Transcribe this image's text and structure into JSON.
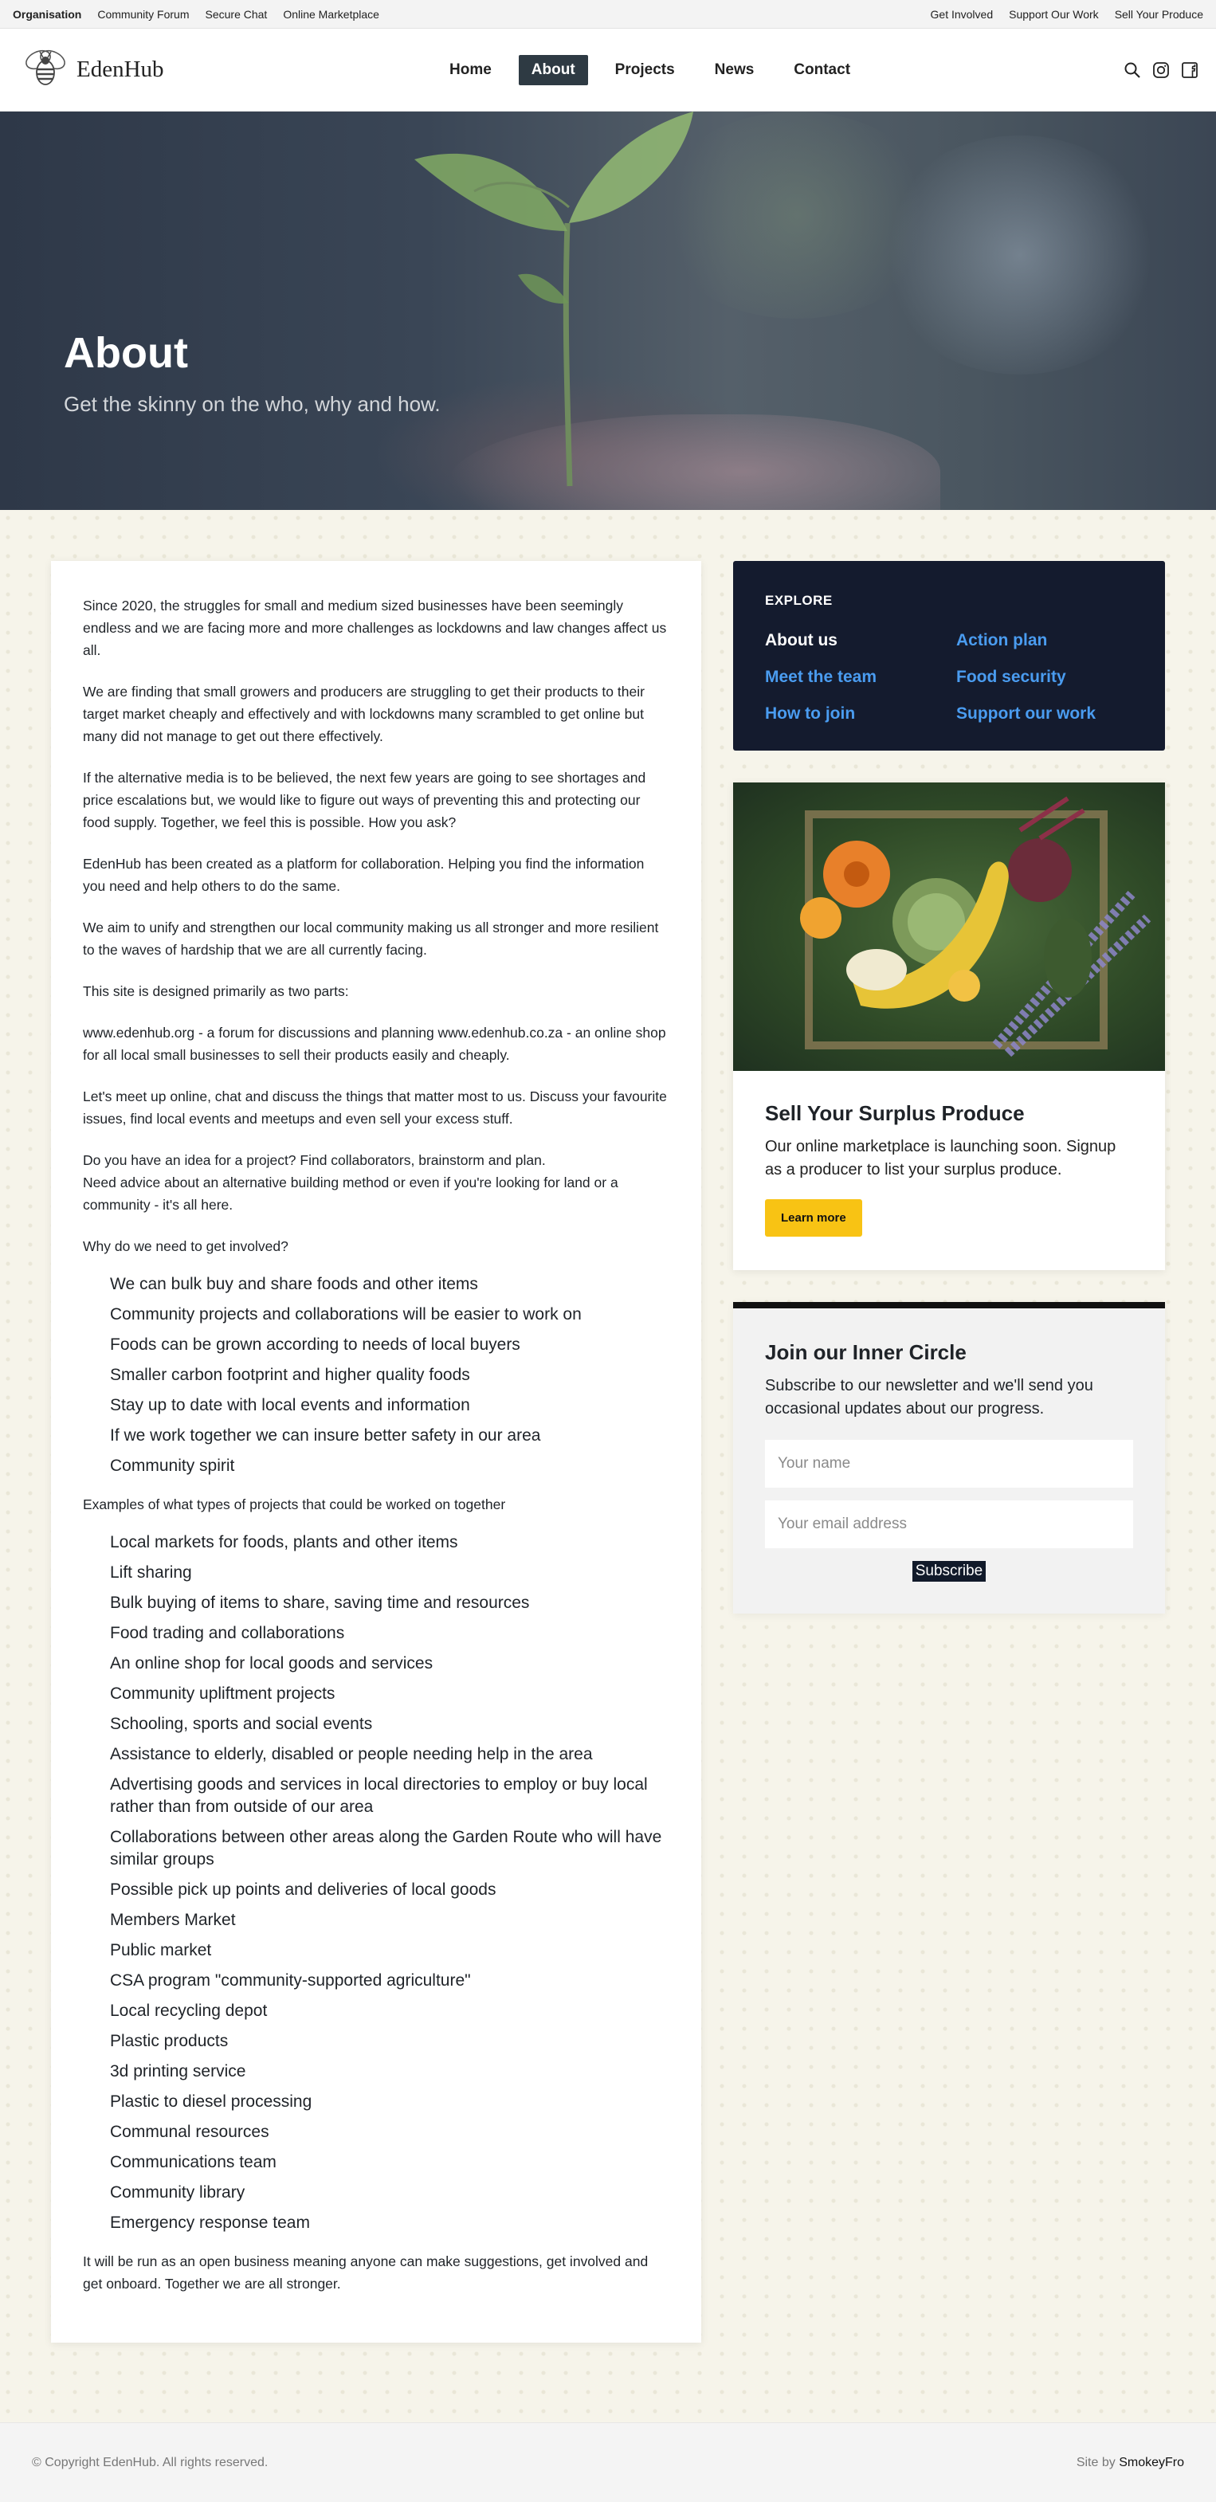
{
  "topbar": {
    "left": [
      "Organisation",
      "Community Forum",
      "Secure Chat",
      "Online Marketplace"
    ],
    "right": [
      "Get Involved",
      "Support Our Work",
      "Sell Your Produce"
    ]
  },
  "header": {
    "logo_text": "EdenHub",
    "nav": [
      "Home",
      "About",
      "Projects",
      "News",
      "Contact"
    ],
    "active_nav": "About",
    "icons": [
      "search-icon",
      "instagram-icon",
      "facebook-icon"
    ]
  },
  "hero": {
    "title": "About",
    "subtitle": "Get the skinny on the who, why and how."
  },
  "article": {
    "paragraphs": [
      "Since 2020, the struggles for small and medium sized businesses have been seemingly endless and we are facing more and more challenges as lockdowns and law changes affect us all.",
      "We are finding that small growers and producers are struggling to get their products to their target market cheaply and effectively and with lockdowns many scrambled to get online but many did not manage to get out there effectively.",
      "If the alternative media is to be believed, the next few years are going to see shortages and price escalations but, we would like to figure out ways of preventing this and protecting our food supply. Together, we feel this is possible. How you ask?",
      "EdenHub has been created as a platform for collaboration. Helping you find the information you need and help others to do the same.",
      "We aim to unify and strengthen our local community making us all stronger and more resilient to the waves of hardship that we are all currently facing.",
      "This site is designed primarily as two parts:",
      "www.edenhub.org - a forum for discussions and planning www.edenhub.co.za - an online shop for all local small businesses to sell their products easily and cheaply.",
      "Let's meet up online, chat and discuss the things that matter most to us. Discuss your favourite issues, find local events and meetups and even sell your excess stuff."
    ],
    "idea_line1": "Do you have an idea for a project? Find collaborators, brainstorm and plan.",
    "idea_line2": "Need advice about an alternative building method or even if you're looking for land or a community - it's all here.",
    "why_heading": "Why do we need to get involved?",
    "why_list": [
      "We can bulk buy and share foods and other items",
      "Community projects and collaborations will be easier to work on",
      "Foods can be grown according to needs of local buyers",
      "Smaller carbon footprint and higher quality foods",
      "Stay up to date with local events and information",
      "If we work together we can insure better safety in our area",
      "Community spirit"
    ],
    "examples_heading": "Examples of what types of projects that could be worked on together",
    "examples_list": [
      "Local markets for foods, plants and other items",
      "Lift sharing",
      "Bulk buying of items to share, saving time and resources",
      "Food trading and collaborations",
      "An online shop for local goods and services",
      "Community upliftment projects",
      "Schooling, sports and social events",
      "Assistance to elderly, disabled or people needing help in the area",
      "Advertising goods and services in local directories to employ or buy local rather than from outside of our area",
      "Collaborations between other areas along the Garden Route who will have similar groups",
      "Possible pick up points and deliveries of local goods",
      "Members Market",
      "Public market",
      "CSA program \"community-supported agriculture\"",
      "Local recycling depot",
      "Plastic products",
      "3d printing service",
      "Plastic to diesel processing",
      "Communal resources",
      "Communications team",
      "Community library",
      "Emergency response team"
    ],
    "closing": "It will be run as an open business meaning anyone can make suggestions, get involved and get onboard. Together we are all stronger."
  },
  "explore": {
    "heading": "EXPLORE",
    "links": [
      "About us",
      "Action plan",
      "Meet the team",
      "Food security",
      "How to join",
      "Support our work"
    ],
    "current": "About us"
  },
  "promo": {
    "title": "Sell Your Surplus Produce",
    "text": "Our online marketplace is launching soon. Signup as a producer to list your surplus produce.",
    "button": "Learn more"
  },
  "newsletter": {
    "title": "Join our Inner Circle",
    "text": "Subscribe to our newsletter and we'll send you occasional updates about our progress.",
    "name_placeholder": "Your name",
    "email_placeholder": "Your email address",
    "button": "Subscribe"
  },
  "footer": {
    "copyright": "© Copyright EdenHub. All rights reserved.",
    "credit_prefix": "Site by",
    "credit_name": "SmokeyFro"
  },
  "colors": {
    "accent_yellow": "#f8c314",
    "explore_bg": "#141b2e",
    "link_blue": "#4a9cf0",
    "nav_active": "#2e3a43"
  }
}
